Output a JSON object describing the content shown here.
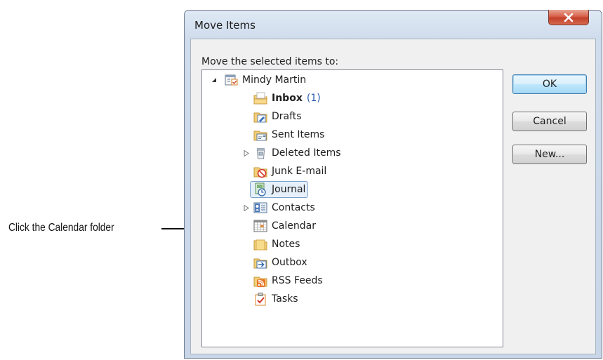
{
  "annotation": {
    "text": "Click the Calendar folder"
  },
  "dialog": {
    "title": "Move Items",
    "prompt": "Move the selected items to:",
    "close_glyph": "X"
  },
  "tree": {
    "root": {
      "label": "Mindy Martin",
      "icon": "mailbox-icon",
      "expanded": true
    },
    "items": [
      {
        "label": "Inbox",
        "count": "(1)",
        "bold": true,
        "icon": "inbox-folder-icon"
      },
      {
        "label": "Drafts",
        "icon": "drafts-folder-icon"
      },
      {
        "label": "Sent Items",
        "icon": "sent-items-folder-icon"
      },
      {
        "label": "Deleted Items",
        "icon": "deleted-items-icon",
        "expandable": true
      },
      {
        "label": "Junk E-mail",
        "icon": "junk-email-icon"
      },
      {
        "label": "Journal",
        "icon": "journal-icon",
        "selected": true
      },
      {
        "label": "Contacts",
        "icon": "contacts-icon",
        "expandable": true
      },
      {
        "label": "Calendar",
        "icon": "calendar-icon"
      },
      {
        "label": "Notes",
        "icon": "notes-folder-icon"
      },
      {
        "label": "Outbox",
        "icon": "outbox-icon"
      },
      {
        "label": "RSS Feeds",
        "icon": "rss-feeds-icon"
      },
      {
        "label": "Tasks",
        "icon": "tasks-icon"
      }
    ]
  },
  "buttons": {
    "ok": "OK",
    "cancel": "Cancel",
    "new": "New..."
  },
  "colors": {
    "selection_bg": "#e6f0fa",
    "selection_border": "#7da2ce",
    "count_blue": "#2a5db0",
    "close_red": "#c2402a"
  }
}
